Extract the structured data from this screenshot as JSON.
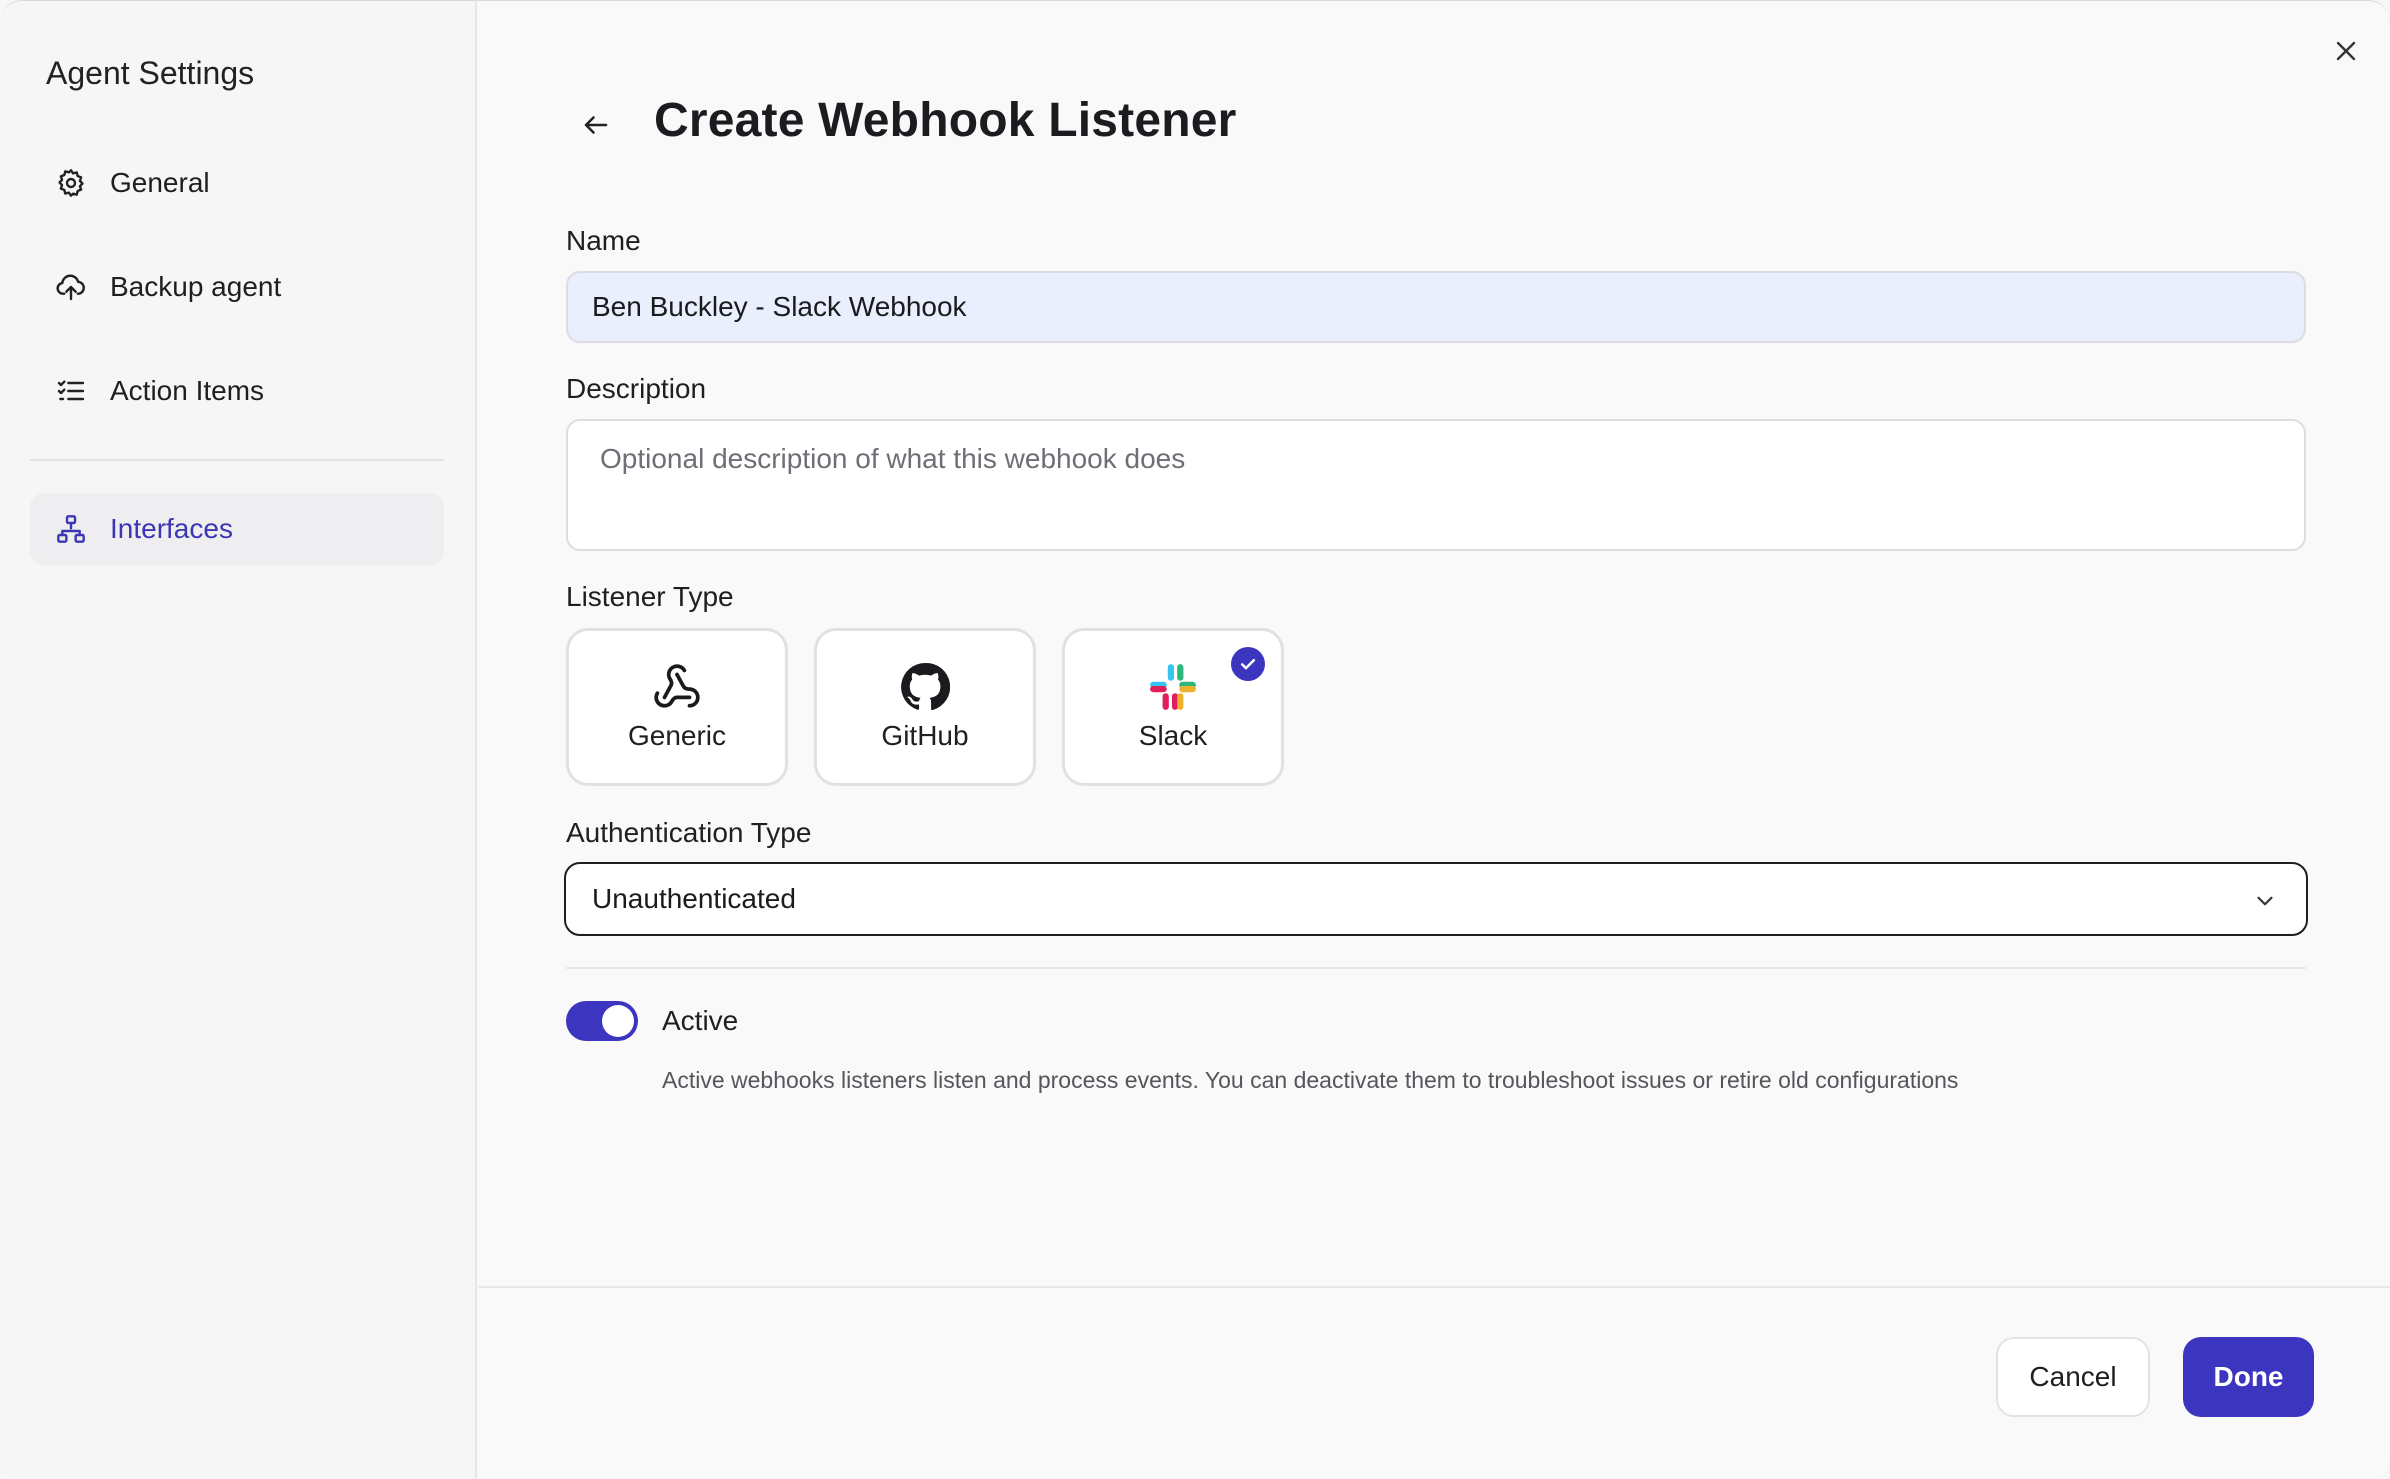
{
  "sidebar": {
    "title": "Agent Settings",
    "items": [
      {
        "label": "General",
        "icon": "gear-icon",
        "active": false
      },
      {
        "label": "Backup agent",
        "icon": "cloud-upload-icon",
        "active": false
      },
      {
        "label": "Action Items",
        "icon": "checklist-icon",
        "active": false
      },
      {
        "label": "Interfaces",
        "icon": "network-icon",
        "active": true
      }
    ]
  },
  "header": {
    "title": "Create Webhook Listener"
  },
  "form": {
    "name_label": "Name",
    "name_value": "Ben Buckley - Slack Webhook",
    "description_label": "Description",
    "description_placeholder": "Optional description of what this webhook does",
    "listener_type_label": "Listener Type",
    "listener_types": [
      {
        "label": "Generic",
        "icon": "webhook-icon",
        "selected": false
      },
      {
        "label": "GitHub",
        "icon": "github-icon",
        "selected": false
      },
      {
        "label": "Slack",
        "icon": "slack-icon",
        "selected": true
      }
    ],
    "auth_label": "Authentication Type",
    "auth_value": "Unauthenticated",
    "active_label": "Active",
    "active_on": true,
    "active_help": "Active webhooks listeners listen and process events. You can deactivate them to troubleshoot issues or retire old configurations"
  },
  "footer": {
    "cancel_label": "Cancel",
    "done_label": "Done"
  },
  "colors": {
    "accent": "#3b35c0",
    "name_field_bg": "#e9effd",
    "sidebar_active_bg": "#eeeef1"
  }
}
